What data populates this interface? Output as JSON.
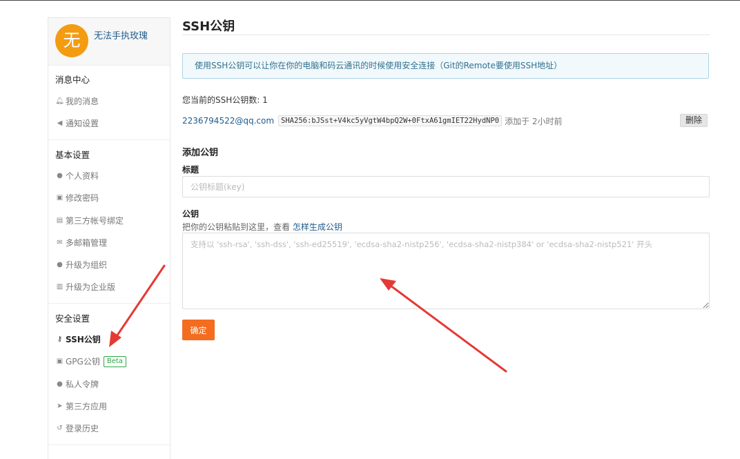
{
  "user": {
    "avatar_letter": "无",
    "name": "无法手执玫瑰"
  },
  "sidebar": {
    "sections": [
      {
        "title": "消息中心",
        "items": [
          {
            "label": "我的消息",
            "icon": "bell-icon"
          },
          {
            "label": "通知设置",
            "icon": "volume-icon"
          }
        ]
      },
      {
        "title": "基本设置",
        "items": [
          {
            "label": "个人资料",
            "icon": "user-icon"
          },
          {
            "label": "修改密码",
            "icon": "lock-icon"
          },
          {
            "label": "第三方帐号绑定",
            "icon": "id-card-icon"
          },
          {
            "label": "多邮箱管理",
            "icon": "envelope-icon"
          },
          {
            "label": "升级为组织",
            "icon": "group-icon"
          },
          {
            "label": "升级为企业版",
            "icon": "building-icon"
          }
        ]
      },
      {
        "title": "安全设置",
        "items": [
          {
            "label": "SSH公钥",
            "icon": "key-icon",
            "active": true
          },
          {
            "label": "GPG公钥",
            "icon": "lock-icon",
            "badge": "Beta"
          },
          {
            "label": "私人令牌",
            "icon": "user-secret-icon"
          },
          {
            "label": "第三方应用",
            "icon": "rocket-icon"
          },
          {
            "label": "登录历史",
            "icon": "history-icon"
          }
        ]
      }
    ]
  },
  "main": {
    "title": "SSH公钥",
    "info": "使用SSH公钥可以让你在你的电脑和码云通讯的时候使用安全连接（Git的Remote要使用SSH地址）",
    "count_label": "您当前的SSH公钥数: 1",
    "key": {
      "email": "2236794522@qq.com",
      "fingerprint": "SHA256:bJSst+V4kc5yVgtW4bpQ2W+0FtxA61gmIET22HydNP0",
      "added": "添加于 2小时前",
      "delete_label": "删除"
    },
    "add_title": "添加公钥",
    "title_label": "标题",
    "title_placeholder": "公钥标题(key)",
    "key_label": "公钥",
    "key_hint": "把你的公钥粘贴到这里，查看 ",
    "key_hint_link": "怎样生成公钥",
    "key_placeholder": "支持以 'ssh-rsa', 'ssh-dss', 'ssh-ed25519', 'ecdsa-sha2-nistp256', 'ecdsa-sha2-nistp384' or 'ecdsa-sha2-nistp521' 开头",
    "submit_label": "确定"
  },
  "colors": {
    "accent": "#f36c1f",
    "link": "#1e5b8c",
    "annotation": "#e53935"
  }
}
